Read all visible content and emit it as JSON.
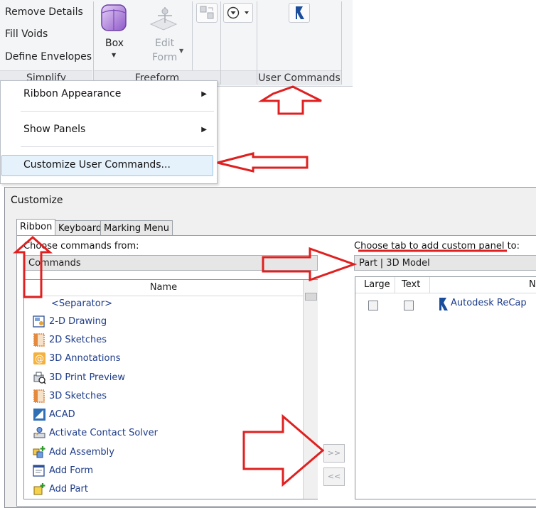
{
  "ribbon": {
    "simplify": {
      "items": [
        "Remove Details",
        "Fill Voids",
        "Define Envelopes"
      ],
      "label": "Simplify"
    },
    "freeform": {
      "box_label": "Box",
      "edit_form_line1": "Edit",
      "edit_form_line2": "Form",
      "label": "Freeform"
    },
    "user_commands": {
      "label": "User Commands"
    }
  },
  "context_menu": {
    "items": [
      "Ribbon Appearance",
      "Show Panels",
      "Customize User Commands..."
    ]
  },
  "dialog": {
    "title": "Customize",
    "tabs": [
      "Ribbon",
      "Keyboard",
      "Marking Menu"
    ],
    "left": {
      "choose_label": "Choose commands from:",
      "combo_value": "Commands",
      "column_name": "Name",
      "items": [
        "<Separator>",
        "2-D Drawing",
        "2D Sketches",
        "3D Annotations",
        "3D Print Preview",
        "3D Sketches",
        "ACAD",
        "Activate Contact Solver",
        "Add Assembly",
        "Add Form",
        "Add Part"
      ]
    },
    "right": {
      "choose_label": "Choose tab to add custom panel to:",
      "combo_value": "Part | 3D Model",
      "columns": [
        "Large",
        "Text",
        "Na"
      ],
      "items": [
        "Autodesk ReCap"
      ]
    },
    "buttons": {
      "add": ">>",
      "remove": "<<"
    }
  },
  "colors": {
    "annotation_red": "#e02020",
    "menu_highlight": "#e5f1fb",
    "link_text": "#1e3c8a"
  }
}
